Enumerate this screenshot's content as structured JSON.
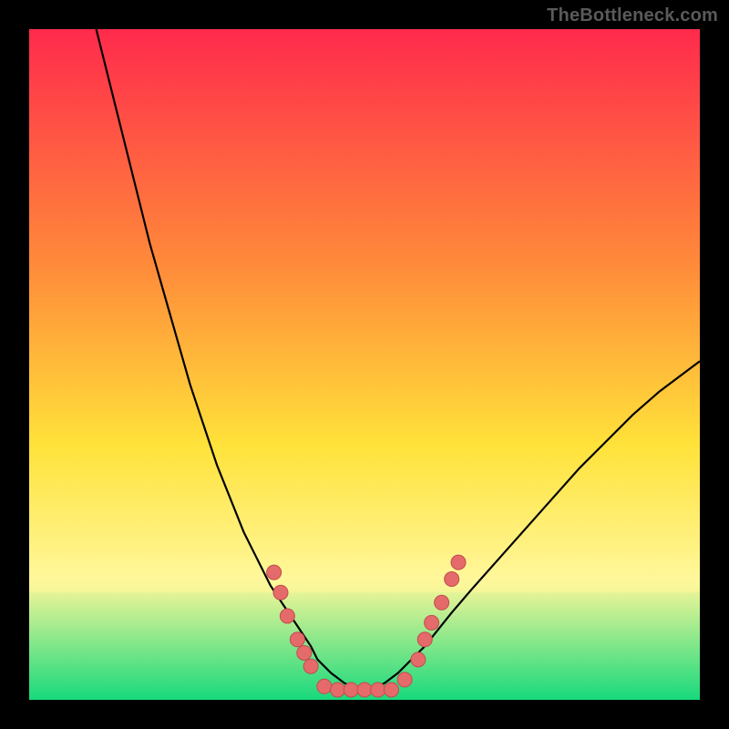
{
  "watermark": "TheBottleneck.com",
  "colors": {
    "frame": "#000000",
    "gradient_top": "#ff2a4c",
    "gradient_mid1": "#ff8a3a",
    "gradient_mid2": "#ffe23a",
    "gradient_yellow_band": "#fff79a",
    "gradient_green": "#17d97c",
    "curve": "#000000",
    "dot_fill": "#e56a6a",
    "dot_stroke": "#c14d4d"
  },
  "chart_data": {
    "type": "line",
    "title": "",
    "xlabel": "",
    "ylabel": "",
    "xlim": [
      0,
      100
    ],
    "ylim": [
      0,
      100
    ],
    "series": [
      {
        "name": "bottleneck-curve",
        "x": [
          10,
          12,
          14,
          16,
          18,
          20,
          22,
          24,
          26,
          28,
          30,
          32,
          34,
          36,
          38,
          40,
          42,
          43,
          45,
          47,
          49,
          51,
          53,
          55,
          57,
          59,
          61,
          63,
          66,
          70,
          74,
          78,
          82,
          86,
          90,
          94,
          98,
          100
        ],
        "y": [
          100,
          92,
          84,
          76,
          68,
          61,
          54,
          47,
          41,
          35,
          30,
          25,
          21,
          17,
          14,
          11,
          8,
          6,
          4,
          2.5,
          1.5,
          1.5,
          2.5,
          4,
          6,
          8,
          10.5,
          13,
          16.5,
          21,
          25.5,
          30,
          34.5,
          38.5,
          42.5,
          46,
          49,
          50.5
        ]
      }
    ],
    "dots": {
      "name": "highlighted-points",
      "points": [
        {
          "x": 36.5,
          "y": 19
        },
        {
          "x": 37.5,
          "y": 16
        },
        {
          "x": 38.5,
          "y": 12.5
        },
        {
          "x": 40,
          "y": 9
        },
        {
          "x": 41,
          "y": 7
        },
        {
          "x": 42,
          "y": 5
        },
        {
          "x": 44,
          "y": 2
        },
        {
          "x": 46,
          "y": 1.5
        },
        {
          "x": 48,
          "y": 1.5
        },
        {
          "x": 50,
          "y": 1.5
        },
        {
          "x": 52,
          "y": 1.5
        },
        {
          "x": 54,
          "y": 1.5
        },
        {
          "x": 56,
          "y": 3
        },
        {
          "x": 58,
          "y": 6
        },
        {
          "x": 59,
          "y": 9
        },
        {
          "x": 60,
          "y": 11.5
        },
        {
          "x": 61.5,
          "y": 14.5
        },
        {
          "x": 63,
          "y": 18
        },
        {
          "x": 64,
          "y": 20.5
        }
      ]
    }
  }
}
